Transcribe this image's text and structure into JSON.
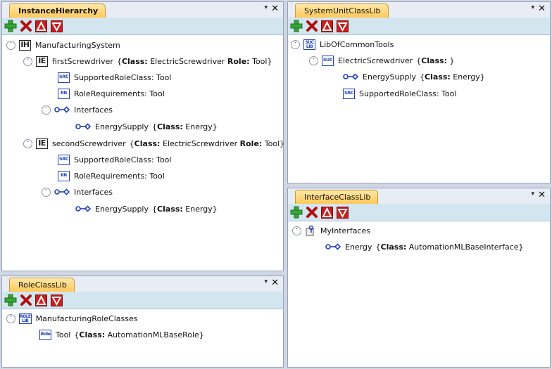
{
  "panels": {
    "instance_hierarchy": {
      "title": "InstanceHierarchy",
      "rows": [
        {
          "label": "ManufacturingSystem",
          "icon": "IH",
          "class_kw": "",
          "class_val": "",
          "role_kw": "",
          "role_val": ""
        },
        {
          "label": "firstScrewdriver",
          "icon": "IE",
          "class_kw": "Class:",
          "class_val": "ElectricScrewdriver",
          "role_kw": "Role:",
          "role_val": "Tool}"
        },
        {
          "label": "SupportedRoleClass: Tool",
          "icon": "SRC"
        },
        {
          "label": "RoleRequirements: Tool",
          "icon": "RR"
        },
        {
          "label": "Interfaces",
          "icon": "interface-icon"
        },
        {
          "label": "EnergySupply",
          "class_kw": "Class:",
          "class_val": "Energy}",
          "icon": "interface-icon"
        },
        {
          "label": "secondScrewdriver",
          "icon": "IE",
          "class_kw": "Class:",
          "class_val": "ElectricScrewdriver",
          "role_kw": "Role:",
          "role_val": "Tool}"
        },
        {
          "label": "SupportedRoleClass: Tool",
          "icon": "SRC"
        },
        {
          "label": "RoleRequirements: Tool",
          "icon": "RR"
        },
        {
          "label": "Interfaces",
          "icon": "interface-icon"
        },
        {
          "label": "EnergySupply",
          "class_kw": "Class:",
          "class_val": "Energy}",
          "icon": "interface-icon"
        }
      ]
    },
    "system_unit_class_lib": {
      "title": "SystemUnitClassLib",
      "rows": [
        {
          "label": "LibOfCommonTools",
          "icon": "SUC LIB"
        },
        {
          "label": "ElectricScrewdriver",
          "class_kw": "Class:",
          "class_val": "}",
          "icon": "SUC"
        },
        {
          "label": "EnergySupply",
          "class_kw": "Class:",
          "class_val": "Energy}",
          "icon": "interface-icon"
        },
        {
          "label": "SupportedRoleClass: Tool",
          "icon": "SRC"
        }
      ]
    },
    "interface_class_lib": {
      "title": "InterfaceClassLib",
      "rows": [
        {
          "label": "MyInterfaces",
          "icon": "interface-lib-icon"
        },
        {
          "label": "Energy",
          "class_kw": "Class:",
          "class_val": "AutomationMLBaseInterface}",
          "icon": "interface-icon"
        }
      ]
    },
    "role_class_lib": {
      "title": "RoleClassLib",
      "rows": [
        {
          "label": "ManufacturingRoleClasses",
          "icon": "ROLE LIB"
        },
        {
          "label": "Tool",
          "class_kw": "Class:",
          "class_val": "AutomationMLBaseRole}",
          "icon": "Role"
        }
      ]
    }
  },
  "brace_open": "{",
  "pin_glyph": "▾",
  "close_glyph": "✕",
  "expand_glyph": "˅",
  "colors": {
    "accent": "#1f3fbd",
    "toolbar": "#d3e6f0",
    "tab": "#ffc95a",
    "delete": "#c81e1e",
    "add": "#3aa53a"
  }
}
